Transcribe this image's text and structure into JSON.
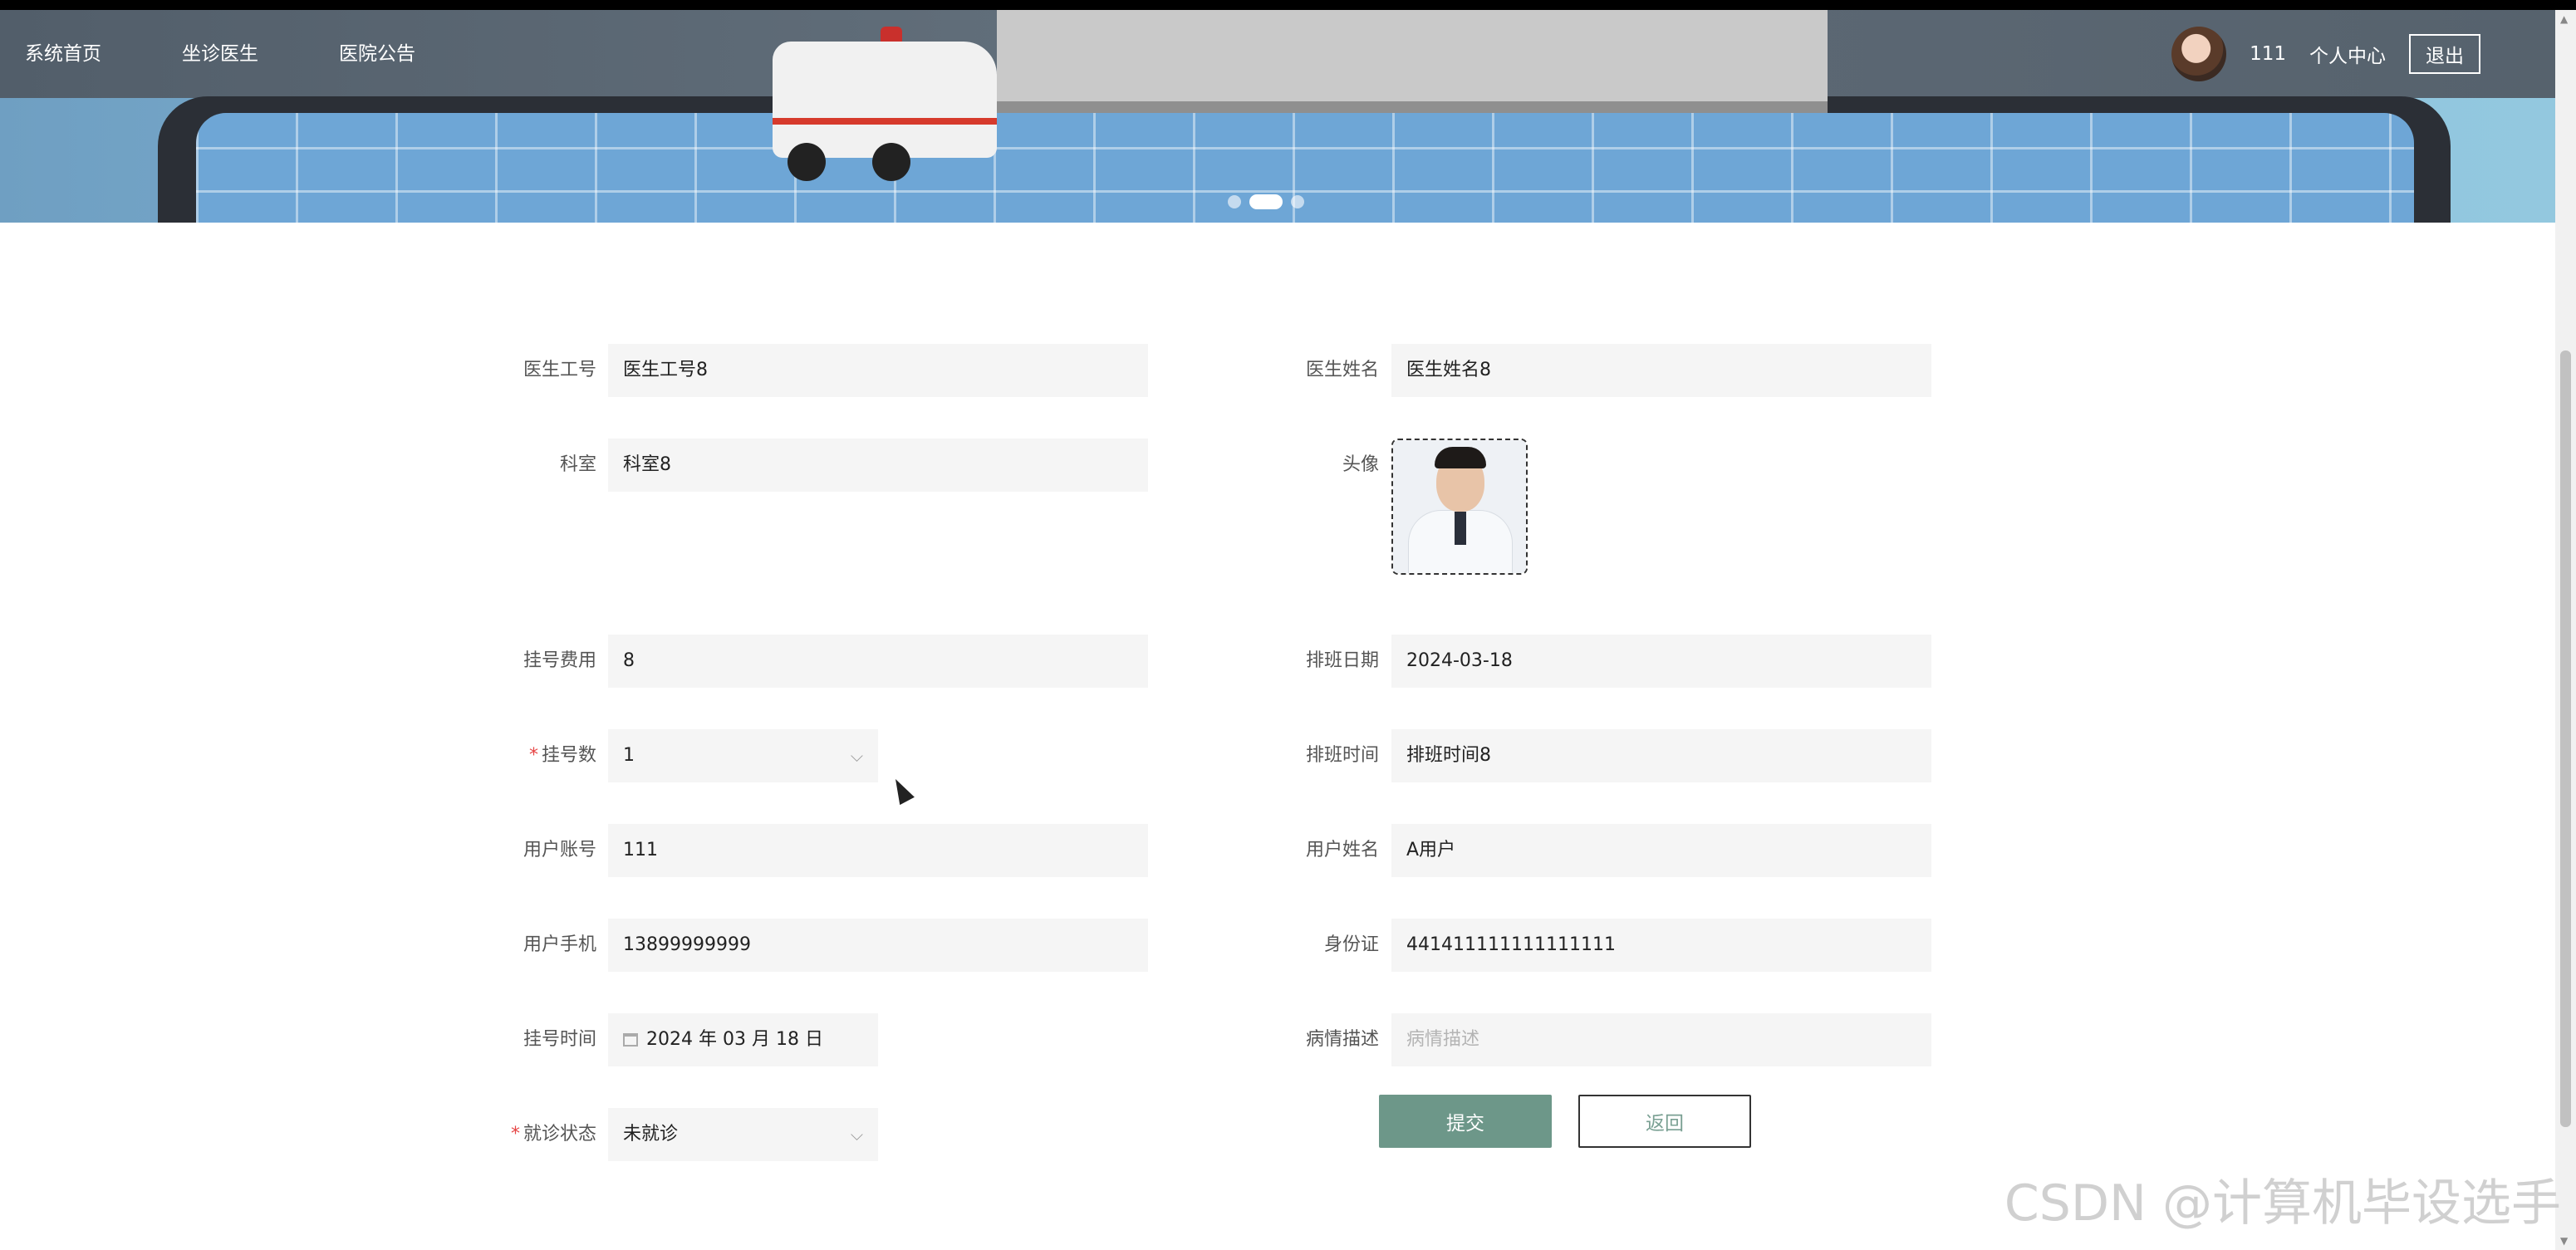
{
  "nav": {
    "items": [
      "系统首页",
      "坐诊医生",
      "医院公告"
    ],
    "username": "111",
    "profile_label": "个人中心",
    "logout_label": "退出"
  },
  "carousel": {
    "slide_count": 3,
    "active_index": 1
  },
  "form": {
    "fields": [
      {
        "label": "医生工号",
        "value": "医生工号8"
      },
      {
        "label": "医生姓名",
        "value": "医生姓名8"
      },
      {
        "label": "科室",
        "value": "科室8"
      },
      {
        "label": "头像"
      },
      {
        "label": "挂号费用",
        "value": "8"
      },
      {
        "label": "排班日期",
        "value": "2024-03-18"
      },
      {
        "label": "挂号数",
        "value": "1",
        "required": true
      },
      {
        "label": "排班时间",
        "value": "排班时间8"
      },
      {
        "label": "用户账号",
        "value": "111"
      },
      {
        "label": "用户姓名",
        "value": "A用户"
      },
      {
        "label": "用户手机",
        "value": "13899999999"
      },
      {
        "label": "身份证",
        "value": "441411111111111111"
      },
      {
        "label": "挂号时间",
        "value": "2024 年 03 月 18 日"
      },
      {
        "label": "病情描述",
        "placeholder": "病情描述"
      },
      {
        "label": "就诊状态",
        "value": "未就诊",
        "required": true
      }
    ],
    "submit_label": "提交",
    "back_label": "返回"
  },
  "icons": {
    "dropdown": "chevron-down-icon",
    "calendar": "calendar-icon"
  },
  "watermark": "CSDN @计算机毕设选手"
}
